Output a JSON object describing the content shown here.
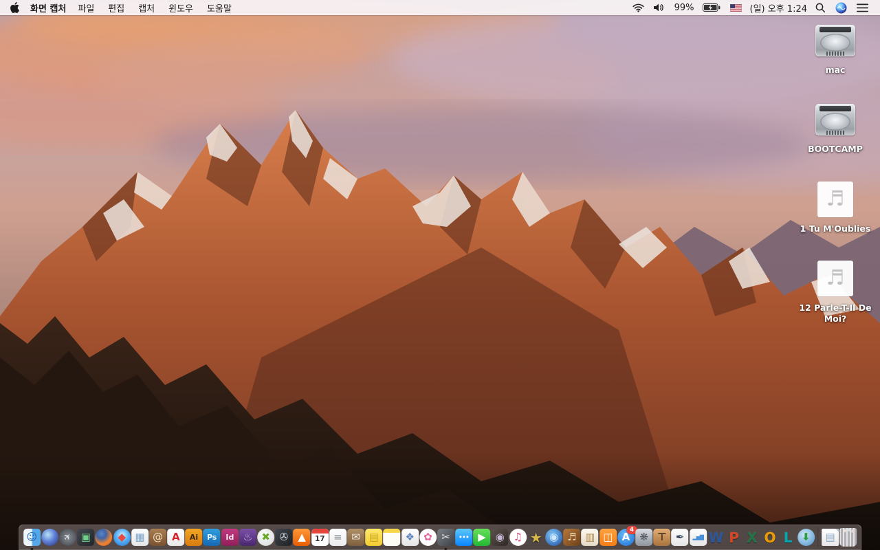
{
  "menu_bar": {
    "apple_menu_icon": "apple-logo",
    "app_name": "화면 캡처",
    "menus": [
      "파일",
      "편집",
      "캡처",
      "윈도우",
      "도움말"
    ],
    "status": {
      "battery_percent": "99%",
      "clock": "(일) 오후 1:24",
      "icons": [
        "wifi-icon",
        "volume-icon",
        "battery-charging-icon",
        "us-flag-icon",
        "spotlight-search-icon",
        "siri-icon",
        "notification-center-icon"
      ]
    }
  },
  "desktop": {
    "wallpaper": "macos-sierra-mountain-sunset",
    "icons": [
      {
        "name": "drive-mac",
        "type": "hard-drive",
        "label": "mac"
      },
      {
        "name": "drive-bootcamp",
        "type": "hard-drive",
        "label": "BOOTCAMP"
      },
      {
        "name": "audio-file-tu-moublies",
        "type": "audio-file",
        "label": "1 Tu M'Oublies"
      },
      {
        "name": "audio-file-parle-t-il-de-moi",
        "type": "audio-file",
        "label": "12 Parle-T-Il De Moi?"
      }
    ]
  },
  "dock": {
    "items": [
      {
        "name": "finder",
        "glyph": "☺",
        "fg": "#1b5fa8",
        "bg": "linear-gradient(90deg,#eef6fc 46%,#54a8ea 54%)",
        "cls": "r",
        "ind": true
      },
      {
        "name": "siri",
        "glyph": "",
        "bg": "radial-gradient(circle at 38% 35%,#b8e4f5 0%,#5f7fd8 45%,#23306e 100%)",
        "cls": "c"
      },
      {
        "name": "launchpad",
        "glyph": "✈",
        "fg": "#dfe3e8",
        "bg": "radial-gradient(circle,#8a8f96 0%,#4e5259 75%)",
        "cls": "c rocket"
      },
      {
        "name": "mission-control",
        "glyph": "▣",
        "fg": "#6fd08a",
        "bg": "linear-gradient(135deg,#43484f,#22252a)",
        "cls": "r"
      },
      {
        "name": "firefox",
        "glyph": "",
        "bg": "radial-gradient(circle at 38% 30%,#5a86c9 0%,#3f64a6 28%,#ef8430 62%,#d4541a 100%)",
        "cls": "c"
      },
      {
        "name": "safari",
        "glyph": "◆",
        "fg": "#e8483f",
        "bg": "radial-gradient(circle at 50% 38%,#cfeeff 0%,#59b0f2 45%,#1f72d8 100%)",
        "cls": "c"
      },
      {
        "name": "preview",
        "glyph": "▦",
        "fg": "#7aa5c9",
        "bg": "linear-gradient(180deg,#fdfdfd,#e4e6e8)",
        "cls": "r"
      },
      {
        "name": "contacts",
        "glyph": "@",
        "fg": "#f3e3c0",
        "bg": "linear-gradient(180deg,#aa7e52,#7a5230)",
        "cls": "r"
      },
      {
        "name": "adobe-acrobat",
        "glyph": "A",
        "fg": "#d6252c",
        "bg": "linear-gradient(180deg,#ffffff,#e9e9e9)",
        "cls": "r bold"
      },
      {
        "name": "adobe-illustrator",
        "glyph": "Ai",
        "fg": "#3a2a10",
        "bg": "linear-gradient(180deg,#f5a623,#d87c10)",
        "cls": "r small"
      },
      {
        "name": "adobe-photoshop",
        "glyph": "Ps",
        "fg": "#eaf6ff",
        "bg": "linear-gradient(180deg,#2f9fe0,#1668b3)",
        "cls": "r small"
      },
      {
        "name": "adobe-indesign",
        "glyph": "Id",
        "fg": "#ffe9f2",
        "bg": "linear-gradient(180deg,#c2397f,#8e1f5a)",
        "cls": "r small"
      },
      {
        "name": "toast-titanium",
        "glyph": "♨",
        "fg": "#d8c8f0",
        "bg": "linear-gradient(180deg,#7a4fa8,#49276e)",
        "cls": "r"
      },
      {
        "name": "green-x-app",
        "glyph": "✖",
        "fg": "#6aaa2a",
        "bg": "radial-gradient(circle at 40% 35%,#ffffff,#d0d3d6)",
        "cls": "c bold"
      },
      {
        "name": "fan-disc-app",
        "glyph": "✇",
        "fg": "#cfd6dd",
        "bg": "linear-gradient(135deg,#41464d,#1e2125)",
        "cls": "r"
      },
      {
        "name": "vlc",
        "glyph": "▲",
        "fg": "#ffffff",
        "bg": "linear-gradient(180deg,#ff9838,#e85d04)",
        "cls": "r"
      },
      {
        "name": "calendar",
        "glyph": "17",
        "cls": "r cal"
      },
      {
        "name": "reminders",
        "glyph": "≡",
        "fg": "#9098a0",
        "bg": "linear-gradient(180deg,#ffffff,#ececec)",
        "cls": "r"
      },
      {
        "name": "document-box-app",
        "glyph": "✉",
        "fg": "#efe8e0",
        "bg": "linear-gradient(180deg,#b09068,#7d5f3e)",
        "cls": "r"
      },
      {
        "name": "stickies",
        "glyph": "▤",
        "fg": "#c9a81f",
        "bg": "linear-gradient(180deg,#ffe96a,#f2cb32)",
        "cls": "r"
      },
      {
        "name": "notes",
        "glyph": "",
        "cls": "r notes"
      },
      {
        "name": "documents-app",
        "glyph": "❖",
        "fg": "#5a7fc0",
        "bg": "linear-gradient(180deg,#ffffff,#e4e4e4)",
        "cls": "r"
      },
      {
        "name": "photos",
        "glyph": "✿",
        "fg": "#e6659a",
        "bg": "radial-gradient(circle,#ffffff 60%,#f3e8ee 100%)",
        "cls": "c"
      },
      {
        "name": "grab-screen-capture",
        "glyph": "✂",
        "fg": "#e8e8e8",
        "bg": "linear-gradient(135deg,#7a7f86,#3c4046)",
        "cls": "r",
        "ind": true
      },
      {
        "name": "messages",
        "glyph": "⋯",
        "fg": "#ffffff",
        "bg": "linear-gradient(180deg,#5ac8fa,#0a84ff)",
        "cls": "r bold"
      },
      {
        "name": "facetime",
        "glyph": "▶",
        "fg": "#ffffff",
        "bg": "linear-gradient(180deg,#67e05a,#23b832)",
        "cls": "r"
      },
      {
        "name": "photo-booth",
        "glyph": "◉",
        "fg": "#c9b8d8",
        "bg": "linear-gradient(135deg,#5c524c,#2e2824)",
        "cls": "r"
      },
      {
        "name": "itunes",
        "glyph": "♫",
        "fg": "#e0457b",
        "bg": "radial-gradient(circle,#ffffff 58%,#f2cfdd 100%)",
        "cls": "c"
      },
      {
        "name": "imovie-star",
        "glyph": "★",
        "fg": "#d8b84a",
        "cls": "plain"
      },
      {
        "name": "idvd",
        "glyph": "◉",
        "fg": "#cfe8ff",
        "bg": "radial-gradient(circle at 40% 35%,#84c5f2,#1a4fa8)",
        "cls": "c"
      },
      {
        "name": "garageband",
        "glyph": "♬",
        "fg": "#f0d9b0",
        "bg": "linear-gradient(135deg,#b5793d,#6e3f18)",
        "cls": "r"
      },
      {
        "name": "clippings-app",
        "glyph": "▥",
        "fg": "#b08a50",
        "bg": "linear-gradient(180deg,#fdf8ef,#e6dbc4)",
        "cls": "r"
      },
      {
        "name": "ibooks",
        "glyph": "◫",
        "fg": "#ffffff",
        "bg": "linear-gradient(180deg,#ffa23e,#f57e17)",
        "cls": "r"
      },
      {
        "name": "app-store",
        "glyph": "A",
        "fg": "#ffffff",
        "bg": "radial-gradient(circle at 40% 35%,#6ab8f7,#1a6fd4)",
        "cls": "c bold",
        "badge": "4"
      },
      {
        "name": "system-preferences",
        "glyph": "❋",
        "fg": "#4e555e",
        "bg": "linear-gradient(180deg,#d8dbe0,#8e959e)",
        "cls": "r"
      },
      {
        "name": "keynote",
        "glyph": "⊤",
        "fg": "#4a2f18",
        "bg": "linear-gradient(180deg,#e2ae74,#a8733c)",
        "cls": "r bold"
      },
      {
        "name": "pages-09",
        "glyph": "✒",
        "fg": "#2e3d52",
        "bg": "linear-gradient(180deg,#fdfdfd,#e6e6e6)",
        "cls": "r"
      },
      {
        "name": "numbers-09",
        "glyph": "▂▅▇",
        "fg": "#4a90d9",
        "bg": "linear-gradient(180deg,#fdfdfd,#e6e6e6)",
        "cls": "r tiny"
      },
      {
        "name": "ms-word",
        "glyph": "W",
        "fg": "#2b579a",
        "cls": "letter"
      },
      {
        "name": "ms-powerpoint",
        "glyph": "P",
        "fg": "#d24726",
        "cls": "letter"
      },
      {
        "name": "ms-excel",
        "glyph": "X",
        "fg": "#217346",
        "cls": "letter"
      },
      {
        "name": "ms-outlook",
        "glyph": "O",
        "fg": "#eb9b00",
        "cls": "letter"
      },
      {
        "name": "ms-lync",
        "glyph": "L",
        "fg": "#00a8b0",
        "cls": "letter"
      },
      {
        "name": "ms-autoupdate-globe",
        "glyph": "⬇",
        "fg": "#2f9e3f",
        "bg": "radial-gradient(circle at 40% 35%,#cfe9f7,#4a90c9)",
        "cls": "c bold"
      },
      {
        "name": "dock-divider",
        "cls": "divider"
      },
      {
        "name": "document-file",
        "glyph": "▤",
        "fg": "#8aa7c4",
        "bg": "linear-gradient(180deg,#ffffff,#e8e8e8)",
        "cls": "page"
      },
      {
        "name": "trash",
        "glyph": "",
        "cls": "trash"
      }
    ]
  }
}
